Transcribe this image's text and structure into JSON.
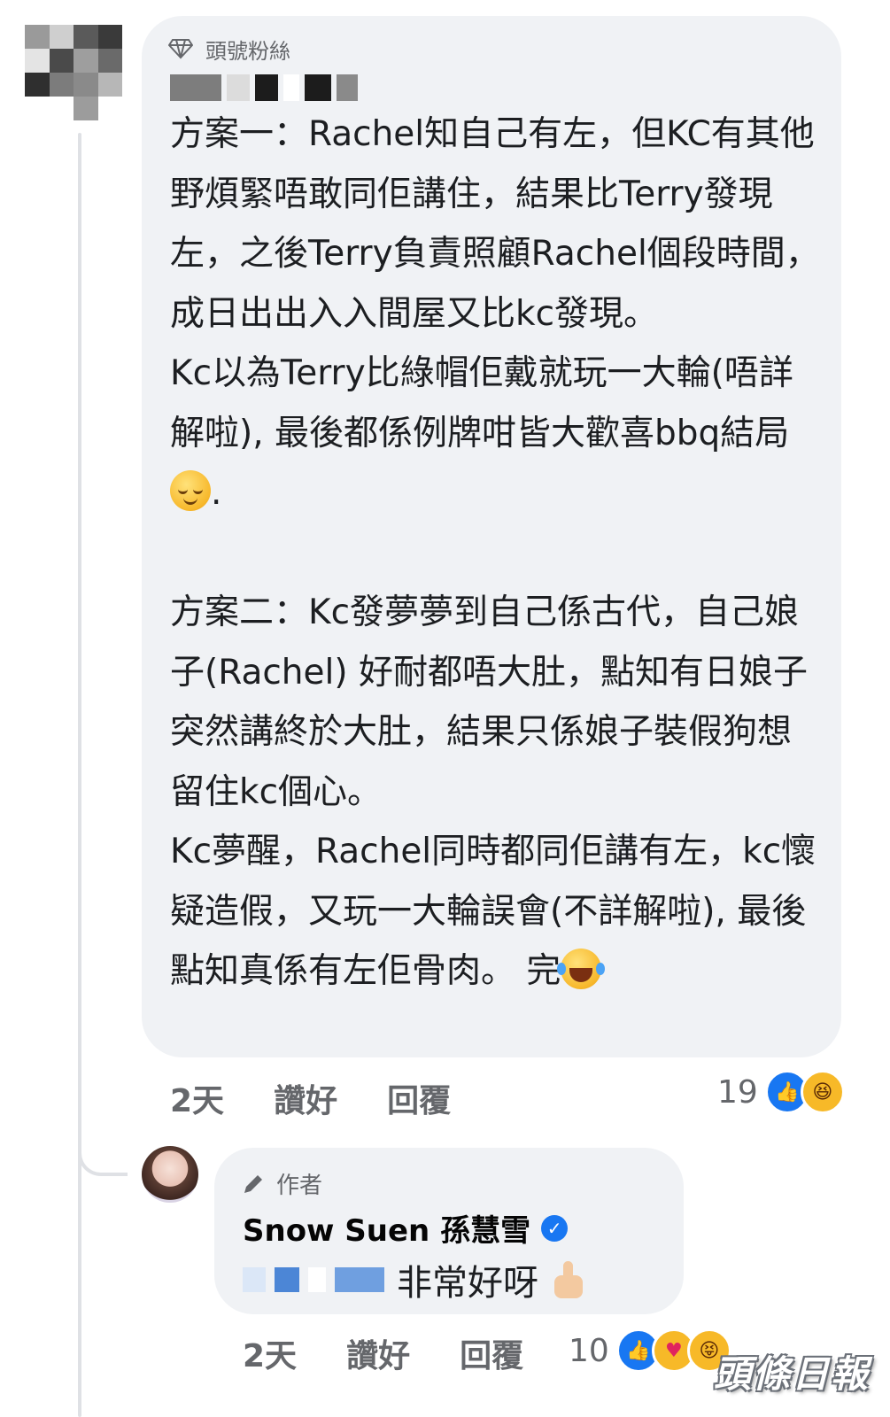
{
  "comment": {
    "badge_label": "頭號粉絲",
    "paragraph_1": "方案一：Rachel知自己有左，但KC有其他野煩緊唔敢同佢講住，結果比Terry發現左，之後Terry負責照顧Rachel個段時間，成日出出入入間屋又比kc發現。",
    "paragraph_2": "Kc以為Terry比綠帽佢戴就玩一大輪(唔詳解啦), 最後都係例牌咁皆大歡喜bbq結局",
    "paragraph_2_end": ".",
    "paragraph_3": "方案二：Kc發夢夢到自己係古代，自己娘子(Rachel) 好耐都唔大肚，點知有日娘子突然講終於大肚，結果只係娘子裝假狗想留住kc個心。",
    "paragraph_4": "Kc夢醒，Rachel同時都同佢講有左，kc懷疑造假，又玩一大輪誤會(不詳解啦), 最後點知真係有左佢骨肉。 完",
    "time": "2天",
    "like_label": "讚好",
    "reply_label": "回覆",
    "reaction_count": "19",
    "reaction_icons": [
      "like-icon",
      "haha-icon"
    ]
  },
  "reply": {
    "author_badge": "作者",
    "author_name": "Snow Suen 孫慧雪",
    "text": "非常好呀",
    "time": "2天",
    "like_label": "讚好",
    "reply_label": "回覆",
    "reaction_count": "10",
    "reaction_icons": [
      "like-icon",
      "care-icon",
      "tongue-icon"
    ]
  },
  "watermark": "頭條日報",
  "colors": {
    "bubble": "#f0f2f5",
    "text": "#1c1e21",
    "meta": "#65676b",
    "like_blue": "#1877f2",
    "emoji_yellow": "#f7b928"
  }
}
